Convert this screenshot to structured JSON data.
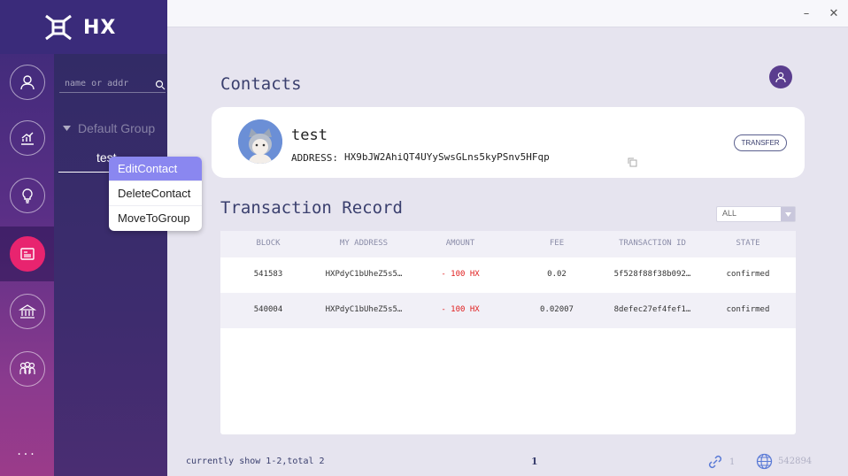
{
  "app": {
    "logo_text": "HX"
  },
  "window": {
    "minimize": "–",
    "close": "✕"
  },
  "nav": {
    "items": [
      {
        "icon": "user-icon"
      },
      {
        "icon": "chart-icon"
      },
      {
        "icon": "bulb-icon"
      },
      {
        "icon": "contacts-icon",
        "active": true
      },
      {
        "icon": "bank-icon"
      },
      {
        "icon": "people-icon"
      }
    ],
    "more": "···"
  },
  "sidebar": {
    "search_placeholder": "name or addr",
    "group_label": "Default Group",
    "contact": "test"
  },
  "context_menu": [
    "EditContact",
    "DeleteContact",
    "MoveToGroup"
  ],
  "contacts": {
    "title": "Contacts",
    "card": {
      "name": "test",
      "address_label": "ADDRESS:",
      "address": "HX9bJW2AhiQT4UYySwsGLns5kyPSnv5HFqp",
      "transfer": "TRANSFER"
    }
  },
  "transactions": {
    "title": "Transaction Record",
    "filter": "ALL",
    "columns": [
      "BLOCK",
      "MY ADDRESS",
      "AMOUNT",
      "FEE",
      "TRANSACTION ID",
      "STATE"
    ],
    "rows": [
      {
        "block": "541583",
        "address": "HXPdyC1bUheZ5s5…",
        "amount": "- 100 HX",
        "fee": "0.02",
        "txid": "5f528f88f38b092…",
        "state": "confirmed"
      },
      {
        "block": "540004",
        "address": "HXPdyC1bUheZ5s5…",
        "amount": "- 100 HX",
        "fee": "0.02007",
        "txid": "8defec27ef4fef1…",
        "state": "confirmed"
      }
    ]
  },
  "footer": {
    "summary": "currently show 1-2,total 2",
    "page": "1",
    "connections": "1",
    "block_height": "542894"
  },
  "colors": {
    "accent": "#e8246f",
    "amount_negative": "#e02020",
    "highlight": "#8a87f0"
  }
}
